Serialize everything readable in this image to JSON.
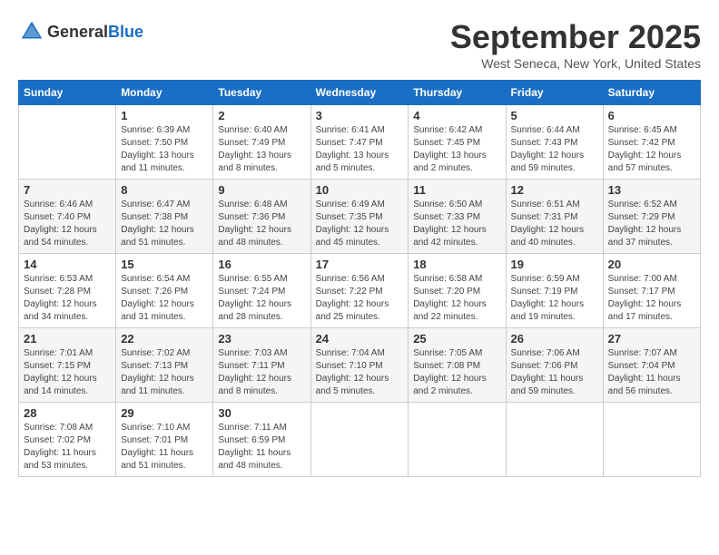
{
  "header": {
    "logo_general": "General",
    "logo_blue": "Blue",
    "month_title": "September 2025",
    "location": "West Seneca, New York, United States"
  },
  "days_of_week": [
    "Sunday",
    "Monday",
    "Tuesday",
    "Wednesday",
    "Thursday",
    "Friday",
    "Saturday"
  ],
  "weeks": [
    [
      {
        "num": "",
        "sunrise": "",
        "sunset": "",
        "daylight": ""
      },
      {
        "num": "1",
        "sunrise": "Sunrise: 6:39 AM",
        "sunset": "Sunset: 7:50 PM",
        "daylight": "Daylight: 13 hours and 11 minutes."
      },
      {
        "num": "2",
        "sunrise": "Sunrise: 6:40 AM",
        "sunset": "Sunset: 7:49 PM",
        "daylight": "Daylight: 13 hours and 8 minutes."
      },
      {
        "num": "3",
        "sunrise": "Sunrise: 6:41 AM",
        "sunset": "Sunset: 7:47 PM",
        "daylight": "Daylight: 13 hours and 5 minutes."
      },
      {
        "num": "4",
        "sunrise": "Sunrise: 6:42 AM",
        "sunset": "Sunset: 7:45 PM",
        "daylight": "Daylight: 13 hours and 2 minutes."
      },
      {
        "num": "5",
        "sunrise": "Sunrise: 6:44 AM",
        "sunset": "Sunset: 7:43 PM",
        "daylight": "Daylight: 12 hours and 59 minutes."
      },
      {
        "num": "6",
        "sunrise": "Sunrise: 6:45 AM",
        "sunset": "Sunset: 7:42 PM",
        "daylight": "Daylight: 12 hours and 57 minutes."
      }
    ],
    [
      {
        "num": "7",
        "sunrise": "Sunrise: 6:46 AM",
        "sunset": "Sunset: 7:40 PM",
        "daylight": "Daylight: 12 hours and 54 minutes."
      },
      {
        "num": "8",
        "sunrise": "Sunrise: 6:47 AM",
        "sunset": "Sunset: 7:38 PM",
        "daylight": "Daylight: 12 hours and 51 minutes."
      },
      {
        "num": "9",
        "sunrise": "Sunrise: 6:48 AM",
        "sunset": "Sunset: 7:36 PM",
        "daylight": "Daylight: 12 hours and 48 minutes."
      },
      {
        "num": "10",
        "sunrise": "Sunrise: 6:49 AM",
        "sunset": "Sunset: 7:35 PM",
        "daylight": "Daylight: 12 hours and 45 minutes."
      },
      {
        "num": "11",
        "sunrise": "Sunrise: 6:50 AM",
        "sunset": "Sunset: 7:33 PM",
        "daylight": "Daylight: 12 hours and 42 minutes."
      },
      {
        "num": "12",
        "sunrise": "Sunrise: 6:51 AM",
        "sunset": "Sunset: 7:31 PM",
        "daylight": "Daylight: 12 hours and 40 minutes."
      },
      {
        "num": "13",
        "sunrise": "Sunrise: 6:52 AM",
        "sunset": "Sunset: 7:29 PM",
        "daylight": "Daylight: 12 hours and 37 minutes."
      }
    ],
    [
      {
        "num": "14",
        "sunrise": "Sunrise: 6:53 AM",
        "sunset": "Sunset: 7:28 PM",
        "daylight": "Daylight: 12 hours and 34 minutes."
      },
      {
        "num": "15",
        "sunrise": "Sunrise: 6:54 AM",
        "sunset": "Sunset: 7:26 PM",
        "daylight": "Daylight: 12 hours and 31 minutes."
      },
      {
        "num": "16",
        "sunrise": "Sunrise: 6:55 AM",
        "sunset": "Sunset: 7:24 PM",
        "daylight": "Daylight: 12 hours and 28 minutes."
      },
      {
        "num": "17",
        "sunrise": "Sunrise: 6:56 AM",
        "sunset": "Sunset: 7:22 PM",
        "daylight": "Daylight: 12 hours and 25 minutes."
      },
      {
        "num": "18",
        "sunrise": "Sunrise: 6:58 AM",
        "sunset": "Sunset: 7:20 PM",
        "daylight": "Daylight: 12 hours and 22 minutes."
      },
      {
        "num": "19",
        "sunrise": "Sunrise: 6:59 AM",
        "sunset": "Sunset: 7:19 PM",
        "daylight": "Daylight: 12 hours and 19 minutes."
      },
      {
        "num": "20",
        "sunrise": "Sunrise: 7:00 AM",
        "sunset": "Sunset: 7:17 PM",
        "daylight": "Daylight: 12 hours and 17 minutes."
      }
    ],
    [
      {
        "num": "21",
        "sunrise": "Sunrise: 7:01 AM",
        "sunset": "Sunset: 7:15 PM",
        "daylight": "Daylight: 12 hours and 14 minutes."
      },
      {
        "num": "22",
        "sunrise": "Sunrise: 7:02 AM",
        "sunset": "Sunset: 7:13 PM",
        "daylight": "Daylight: 12 hours and 11 minutes."
      },
      {
        "num": "23",
        "sunrise": "Sunrise: 7:03 AM",
        "sunset": "Sunset: 7:11 PM",
        "daylight": "Daylight: 12 hours and 8 minutes."
      },
      {
        "num": "24",
        "sunrise": "Sunrise: 7:04 AM",
        "sunset": "Sunset: 7:10 PM",
        "daylight": "Daylight: 12 hours and 5 minutes."
      },
      {
        "num": "25",
        "sunrise": "Sunrise: 7:05 AM",
        "sunset": "Sunset: 7:08 PM",
        "daylight": "Daylight: 12 hours and 2 minutes."
      },
      {
        "num": "26",
        "sunrise": "Sunrise: 7:06 AM",
        "sunset": "Sunset: 7:06 PM",
        "daylight": "Daylight: 11 hours and 59 minutes."
      },
      {
        "num": "27",
        "sunrise": "Sunrise: 7:07 AM",
        "sunset": "Sunset: 7:04 PM",
        "daylight": "Daylight: 11 hours and 56 minutes."
      }
    ],
    [
      {
        "num": "28",
        "sunrise": "Sunrise: 7:08 AM",
        "sunset": "Sunset: 7:02 PM",
        "daylight": "Daylight: 11 hours and 53 minutes."
      },
      {
        "num": "29",
        "sunrise": "Sunrise: 7:10 AM",
        "sunset": "Sunset: 7:01 PM",
        "daylight": "Daylight: 11 hours and 51 minutes."
      },
      {
        "num": "30",
        "sunrise": "Sunrise: 7:11 AM",
        "sunset": "Sunset: 6:59 PM",
        "daylight": "Daylight: 11 hours and 48 minutes."
      },
      {
        "num": "",
        "sunrise": "",
        "sunset": "",
        "daylight": ""
      },
      {
        "num": "",
        "sunrise": "",
        "sunset": "",
        "daylight": ""
      },
      {
        "num": "",
        "sunrise": "",
        "sunset": "",
        "daylight": ""
      },
      {
        "num": "",
        "sunrise": "",
        "sunset": "",
        "daylight": ""
      }
    ]
  ]
}
